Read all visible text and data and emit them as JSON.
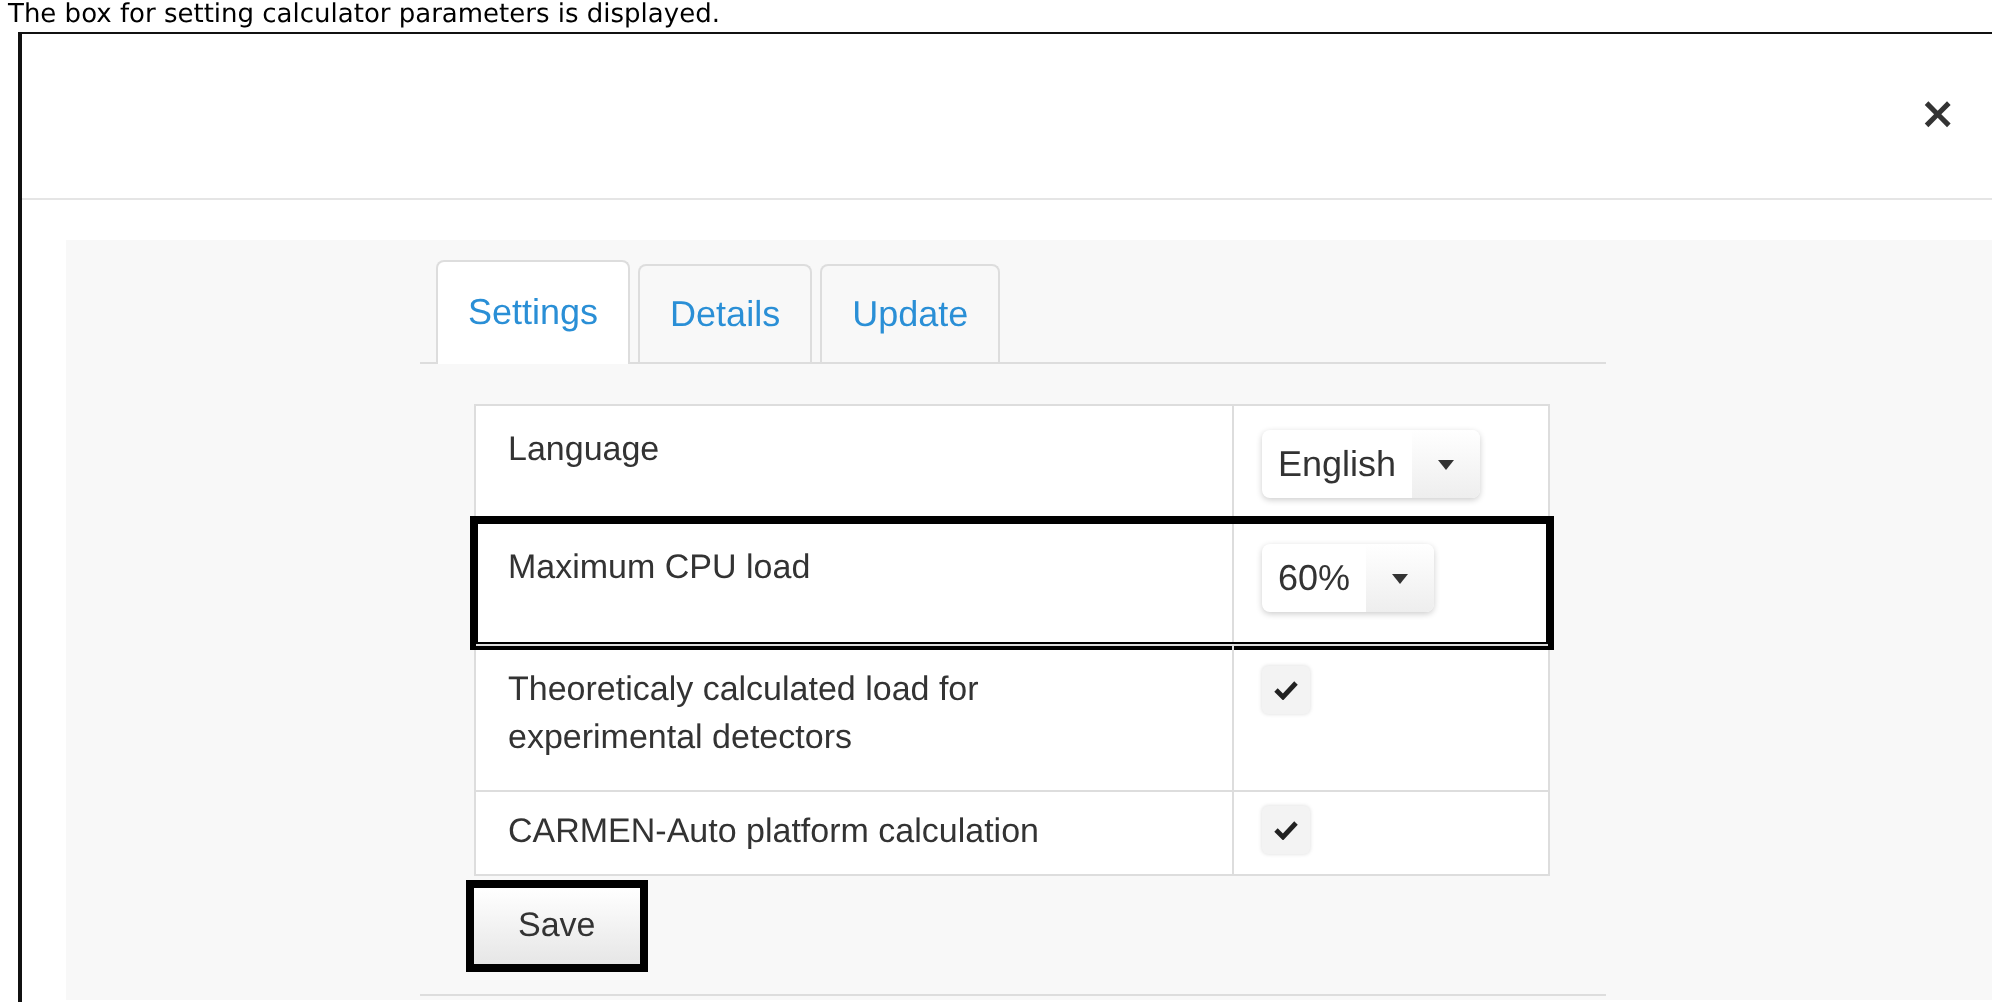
{
  "caption": "The box for setting calculator parameters is displayed.",
  "dialog": {
    "close": "×",
    "tabs": [
      {
        "label": "Settings",
        "selected": true
      },
      {
        "label": "Details",
        "selected": false
      },
      {
        "label": "Update",
        "selected": false
      }
    ],
    "rows": [
      {
        "label": "Language",
        "kind": "select",
        "value": "English",
        "highlighted": false
      },
      {
        "label": "Maximum CPU load",
        "kind": "select",
        "value": "60%",
        "highlighted": true
      },
      {
        "label": "Theoreticaly calculated load for experimental detectors",
        "kind": "checkbox",
        "checked": true,
        "highlighted": false
      },
      {
        "label": "CARMEN-Auto platform calculation",
        "kind": "checkbox",
        "checked": true,
        "highlighted": false
      }
    ],
    "save": {
      "label": "Save",
      "highlighted": true
    }
  }
}
